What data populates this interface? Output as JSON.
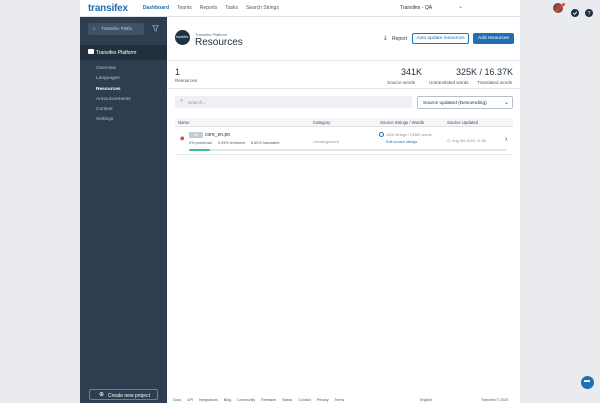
{
  "nav": {
    "logo": "transifex",
    "links": [
      {
        "label": "Dashboard",
        "active": true
      },
      {
        "label": "Teams",
        "active": false
      },
      {
        "label": "Reports",
        "active": false
      },
      {
        "label": "Tasks",
        "active": false
      },
      {
        "label": "Search Strings",
        "active": false
      }
    ],
    "org": "Transifex - QA",
    "icons": [
      "chevron-down-icon",
      "check-circle-icon",
      "help-icon"
    ]
  },
  "sidebar": {
    "project_select": "Transifex Platfo",
    "project_name": "Transifex Platform",
    "items": [
      "Overview",
      "Languages",
      "Resources",
      "Announcements",
      "Context",
      "Settings"
    ],
    "active_item": "Resources",
    "create_label": "Create new project"
  },
  "header": {
    "badge": "transifex",
    "breadcrumb": "Transifex Platform",
    "title": "Resources",
    "report_label": "Report",
    "auto_update_label": "Auto update resources",
    "add_label": "Add resources"
  },
  "stats": {
    "resources": {
      "value": "1",
      "label": "Resources"
    },
    "source_words": {
      "value": "341K",
      "label": "Source words"
    },
    "untranslated": {
      "value": "325K / 16.37K",
      "label1": "Untranslated words",
      "label2": "Translated words"
    }
  },
  "filter": {
    "search_placeholder": "Search...",
    "sort_value": "Source updated (Descending)"
  },
  "table": {
    "columns": [
      "Name",
      "Category",
      "Source Strings / Words",
      "Source Updated"
    ],
    "rows": [
      {
        "lang": "EN",
        "name": "core_en.po",
        "proofread": "0% proofread",
        "reviewed": "0.03% reviewed",
        "translated": "6.62% translated",
        "progress": 0.0662,
        "category": "Uncategorized",
        "strings": "3406 strings / 24360 words",
        "edit_link": "Edit source strings",
        "updated": "Aug 3rd 2020, 11:06"
      }
    ]
  },
  "footer": {
    "links": [
      "Docs",
      "API",
      "Integrations",
      "Blog",
      "Community",
      "Releases",
      "Status",
      "Contact",
      "Privacy",
      "Terms"
    ],
    "language": "English",
    "copyright": "Transifex © 2020"
  },
  "colors": {
    "brand": "#1f6fb2",
    "sidebar": "#2c3e50",
    "progress": "#3fbf88"
  }
}
